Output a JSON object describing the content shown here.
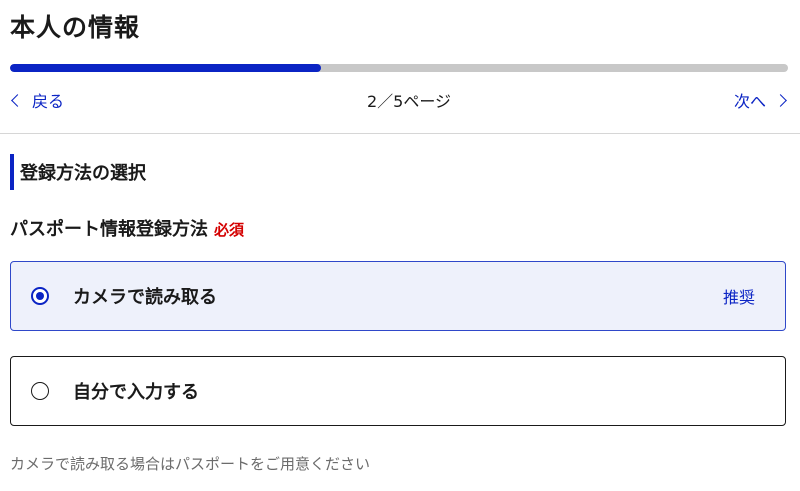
{
  "page": {
    "title": "本人の情報"
  },
  "progress": {
    "current": 2,
    "total": 5,
    "fraction": 0.4,
    "indicator_text": "2／5ページ"
  },
  "nav": {
    "back_label": "戻る",
    "next_label": "次へ"
  },
  "section": {
    "heading": "登録方法の選択"
  },
  "field": {
    "label": "パスポート情報登録方法",
    "required_label": "必須"
  },
  "options": [
    {
      "label": "カメラで読み取る",
      "badge": "推奨",
      "selected": true
    },
    {
      "label": "自分で入力する",
      "badge": "",
      "selected": false
    }
  ],
  "hint": "カメラで読み取る場合はパスポートをご用意ください",
  "colors": {
    "accent": "#0b24c4",
    "required": "#d40000",
    "selected_bg": "#eef1fb",
    "progress_track": "#c8c8c8"
  }
}
